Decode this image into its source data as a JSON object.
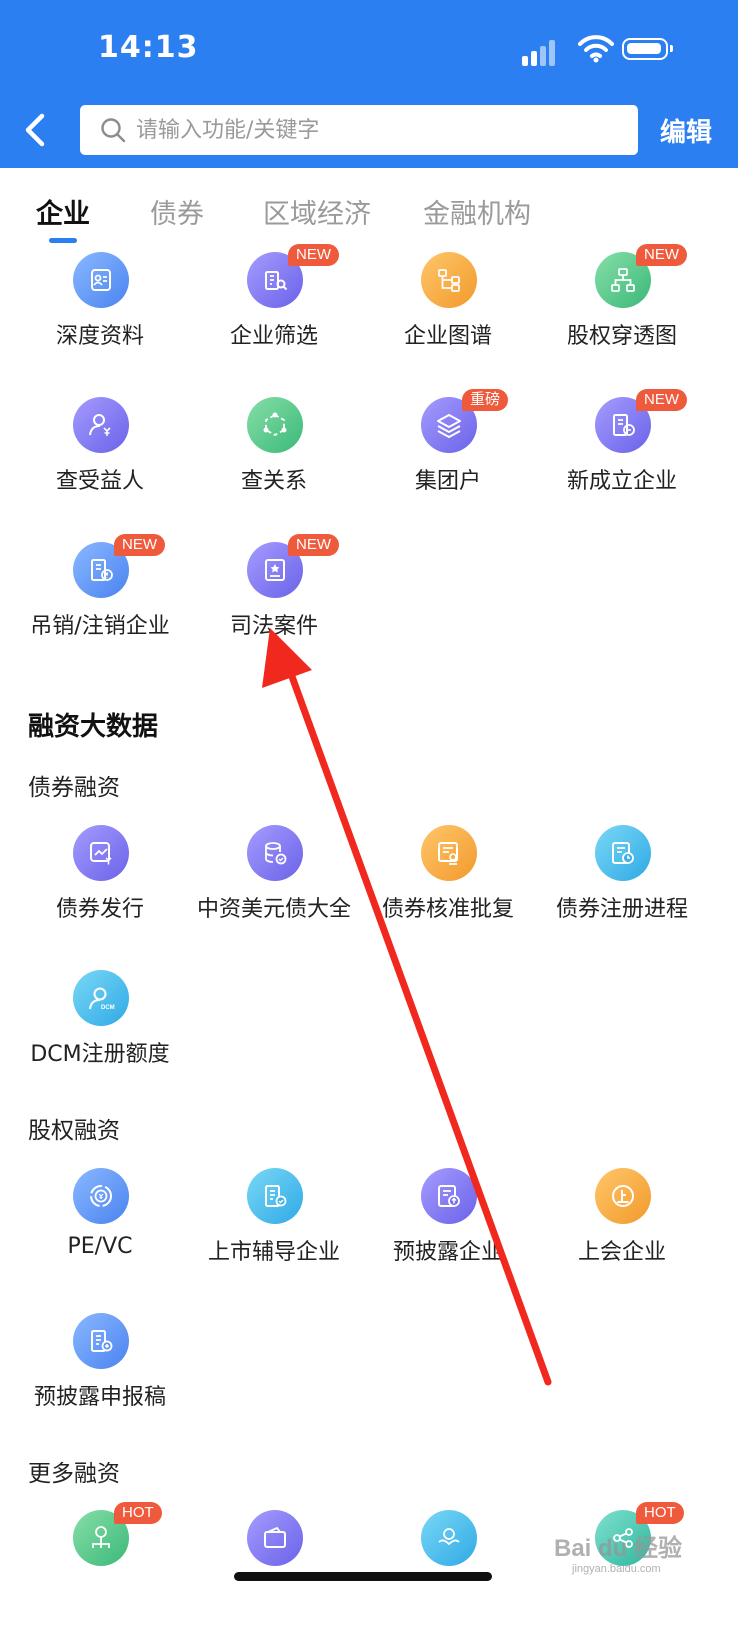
{
  "status_bar": {
    "time": "14:13"
  },
  "header": {
    "search_placeholder": "请输入功能/关键字",
    "edit_label": "编辑"
  },
  "tabs": [
    {
      "label": "企业",
      "active": true
    },
    {
      "label": "债券",
      "active": false
    },
    {
      "label": "区域经济",
      "active": false
    },
    {
      "label": "金融机构",
      "active": false
    }
  ],
  "enterprise": {
    "items": [
      {
        "label": "深度资料",
        "icon": "profile-card-icon",
        "color": "#6fa3f7"
      },
      {
        "label": "企业筛选",
        "icon": "building-search-icon",
        "color": "#7b85f0",
        "badge": "NEW"
      },
      {
        "label": "企业图谱",
        "icon": "org-chart-icon",
        "color": "#f5ab45"
      },
      {
        "label": "股权穿透图",
        "icon": "hierarchy-icon",
        "color": "#5ecb8f",
        "badge": "NEW"
      },
      {
        "label": "查受益人",
        "icon": "person-yuan-icon",
        "color": "#8b7ff2"
      },
      {
        "label": "查关系",
        "icon": "network-icon",
        "color": "#5ecb8f"
      },
      {
        "label": "集团户",
        "icon": "layers-icon",
        "color": "#8b7ff2",
        "badge": "重磅"
      },
      {
        "label": "新成立企业",
        "icon": "building-new-icon",
        "color": "#7b85f0",
        "badge": "NEW"
      },
      {
        "label": "吊销/注销企业",
        "icon": "building-alert-icon",
        "color": "#6fa3f7",
        "badge": "NEW"
      },
      {
        "label": "司法案件",
        "icon": "legal-case-icon",
        "color": "#8b7ff2",
        "badge": "NEW"
      }
    ]
  },
  "financing": {
    "title": "融资大数据",
    "bond": {
      "title": "债券融资",
      "items": [
        {
          "label": "债券发行",
          "icon": "chart-yuan-icon"
        },
        {
          "label": "中资美元债大全",
          "icon": "database-check-icon"
        },
        {
          "label": "债券核准批复",
          "icon": "document-stamp-icon"
        },
        {
          "label": "债券注册进程",
          "icon": "document-clock-icon"
        },
        {
          "label": "DCM注册额度",
          "icon": "person-dcm-icon"
        }
      ]
    },
    "equity": {
      "title": "股权融资",
      "items": [
        {
          "label": "PE/VC",
          "icon": "coin-yuan-icon"
        },
        {
          "label": "上市辅导企业",
          "icon": "building-check-icon"
        },
        {
          "label": "预披露企业",
          "icon": "document-upload-icon"
        },
        {
          "label": "上会企业",
          "icon": "circle-shang-icon"
        },
        {
          "label": "预披露申报稿",
          "icon": "building-plus-icon"
        }
      ]
    },
    "more": {
      "title": "更多融资",
      "items": [
        {
          "label": "",
          "icon": "tree-yuan-icon",
          "badge": "HOT"
        },
        {
          "label": "",
          "icon": "wallet-icon"
        },
        {
          "label": "",
          "icon": "hands-icon"
        },
        {
          "label": "",
          "icon": "share-icon",
          "badge": "HOT"
        }
      ]
    }
  },
  "watermark": {
    "main": "Bai du 经验",
    "sub": "jingyan.baidu.com"
  }
}
